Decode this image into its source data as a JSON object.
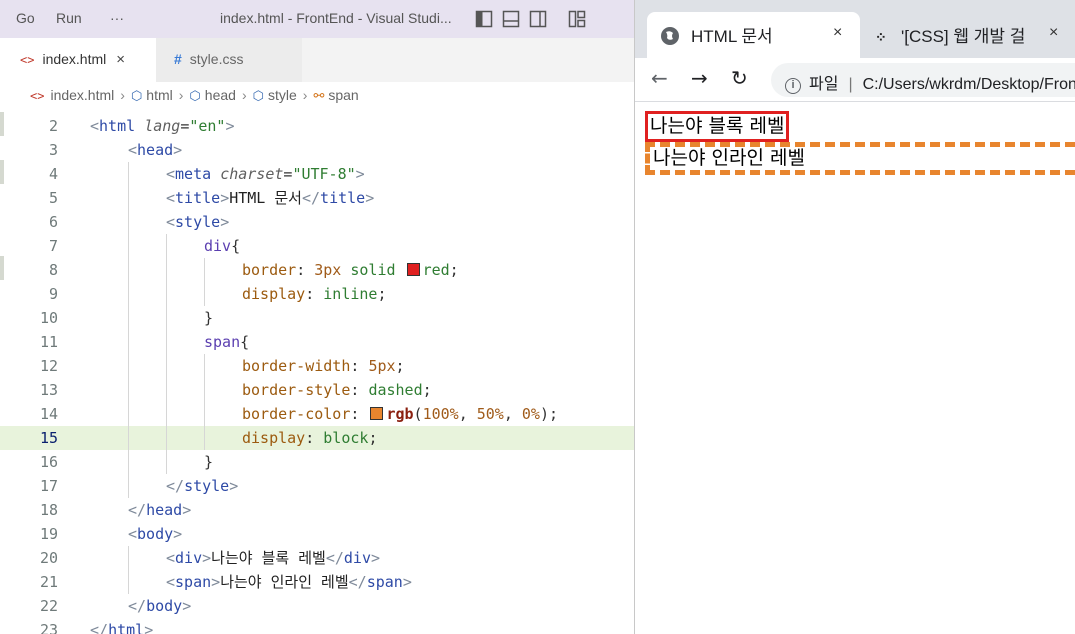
{
  "vscode": {
    "menu": [
      "Go",
      "Run",
      "···"
    ],
    "window_title": "index.html - FrontEnd - Visual Studi...",
    "tabs": [
      {
        "icon": "<>",
        "label": "index.html",
        "close": "×"
      },
      {
        "icon": "#",
        "label": "style.css"
      }
    ],
    "breadcrumbs": [
      "index.html",
      "html",
      "head",
      "style",
      "span"
    ],
    "breadcrumb_sep": "›",
    "current_line": 15,
    "lines": [
      {
        "n": "2",
        "indent": 0,
        "parts": [
          [
            "bracket",
            "<"
          ],
          [
            "tag",
            "html"
          ],
          [
            "text",
            " "
          ],
          [
            "attr",
            "lang"
          ],
          [
            "punc",
            "="
          ],
          [
            "str",
            "\"en\""
          ],
          [
            "bracket",
            ">"
          ]
        ]
      },
      {
        "n": "3",
        "indent": 1,
        "parts": [
          [
            "bracket",
            "<"
          ],
          [
            "tag",
            "head"
          ],
          [
            "bracket",
            ">"
          ]
        ]
      },
      {
        "n": "4",
        "indent": 2,
        "parts": [
          [
            "bracket",
            "<"
          ],
          [
            "tag",
            "meta"
          ],
          [
            "text",
            " "
          ],
          [
            "attr",
            "charset"
          ],
          [
            "punc",
            "="
          ],
          [
            "str",
            "\"UTF-8\""
          ],
          [
            "bracket",
            ">"
          ]
        ]
      },
      {
        "n": "5",
        "indent": 2,
        "parts": [
          [
            "bracket",
            "<"
          ],
          [
            "tag",
            "title"
          ],
          [
            "bracket",
            ">"
          ],
          [
            "text",
            "HTML 문서"
          ],
          [
            "bracket",
            "</"
          ],
          [
            "tag",
            "title"
          ],
          [
            "bracket",
            ">"
          ]
        ]
      },
      {
        "n": "6",
        "indent": 2,
        "parts": [
          [
            "bracket",
            "<"
          ],
          [
            "tag",
            "style"
          ],
          [
            "bracket",
            ">"
          ]
        ]
      },
      {
        "n": "7",
        "indent": 3,
        "parts": [
          [
            "sel",
            "div"
          ],
          [
            "punc",
            "{"
          ]
        ]
      },
      {
        "n": "8",
        "indent": 4,
        "parts": [
          [
            "prop",
            "border"
          ],
          [
            "punc",
            ": "
          ],
          [
            "num",
            "3px"
          ],
          [
            "val",
            " solid "
          ],
          [
            "swatch",
            "#e02020"
          ],
          [
            "val",
            "red"
          ],
          [
            "punc",
            ";"
          ]
        ]
      },
      {
        "n": "9",
        "indent": 4,
        "parts": [
          [
            "prop",
            "display"
          ],
          [
            "punc",
            ": "
          ],
          [
            "val",
            "inline"
          ],
          [
            "punc",
            ";"
          ]
        ]
      },
      {
        "n": "10",
        "indent": 3,
        "parts": [
          [
            "punc",
            "}"
          ]
        ]
      },
      {
        "n": "11",
        "indent": 3,
        "parts": [
          [
            "sel",
            "span"
          ],
          [
            "punc",
            "{"
          ]
        ]
      },
      {
        "n": "12",
        "indent": 4,
        "parts": [
          [
            "prop",
            "border-width"
          ],
          [
            "punc",
            ": "
          ],
          [
            "num",
            "5px"
          ],
          [
            "punc",
            ";"
          ]
        ]
      },
      {
        "n": "13",
        "indent": 4,
        "parts": [
          [
            "prop",
            "border-style"
          ],
          [
            "punc",
            ": "
          ],
          [
            "val",
            "dashed"
          ],
          [
            "punc",
            ";"
          ]
        ]
      },
      {
        "n": "14",
        "indent": 4,
        "parts": [
          [
            "prop",
            "border-color"
          ],
          [
            "punc",
            ": "
          ],
          [
            "swatch",
            "#e8852e"
          ],
          [
            "fn",
            "rgb"
          ],
          [
            "punc",
            "("
          ],
          [
            "num",
            "100%"
          ],
          [
            "punc",
            ", "
          ],
          [
            "num",
            "50%"
          ],
          [
            "punc",
            ", "
          ],
          [
            "num",
            "0%"
          ],
          [
            "punc",
            ");"
          ]
        ]
      },
      {
        "n": "15",
        "indent": 4,
        "parts": [
          [
            "prop",
            "display"
          ],
          [
            "punc",
            ": "
          ],
          [
            "val",
            "block"
          ],
          [
            "punc",
            ";"
          ]
        ]
      },
      {
        "n": "16",
        "indent": 3,
        "parts": [
          [
            "punc",
            "}"
          ]
        ]
      },
      {
        "n": "17",
        "indent": 2,
        "parts": [
          [
            "bracket",
            "</"
          ],
          [
            "tag",
            "style"
          ],
          [
            "bracket",
            ">"
          ]
        ]
      },
      {
        "n": "18",
        "indent": 1,
        "parts": [
          [
            "bracket",
            "</"
          ],
          [
            "tag",
            "head"
          ],
          [
            "bracket",
            ">"
          ]
        ]
      },
      {
        "n": "19",
        "indent": 1,
        "parts": [
          [
            "bracket",
            "<"
          ],
          [
            "tag",
            "body"
          ],
          [
            "bracket",
            ">"
          ]
        ]
      },
      {
        "n": "20",
        "indent": 2,
        "parts": [
          [
            "bracket",
            "<"
          ],
          [
            "tag",
            "div"
          ],
          [
            "bracket",
            ">"
          ],
          [
            "text",
            "나는야 블록 레벨"
          ],
          [
            "bracket",
            "</"
          ],
          [
            "tag",
            "div"
          ],
          [
            "bracket",
            ">"
          ]
        ]
      },
      {
        "n": "21",
        "indent": 2,
        "parts": [
          [
            "bracket",
            "<"
          ],
          [
            "tag",
            "span"
          ],
          [
            "bracket",
            ">"
          ],
          [
            "text",
            "나는야 인라인 레벨"
          ],
          [
            "bracket",
            "</"
          ],
          [
            "tag",
            "span"
          ],
          [
            "bracket",
            ">"
          ]
        ]
      },
      {
        "n": "22",
        "indent": 1,
        "parts": [
          [
            "bracket",
            "</"
          ],
          [
            "tag",
            "body"
          ],
          [
            "bracket",
            ">"
          ]
        ]
      },
      {
        "n": "23",
        "indent": 0,
        "parts": [
          [
            "bracket",
            "</"
          ],
          [
            "tag",
            "html"
          ],
          [
            "bracket",
            ">"
          ]
        ]
      }
    ]
  },
  "browser": {
    "active_tab": {
      "title": "HTML 문서",
      "close": "×"
    },
    "other_tab": {
      "title": "'[CSS] 웹 개발 걸",
      "close": "×"
    },
    "nav": {
      "back": "←",
      "forward": "→",
      "reload": "↻"
    },
    "omnibox": {
      "info": "i",
      "scheme_label": "파일",
      "sep": "|",
      "url": "C:/Users/wkrdm/Desktop/FrontEnd/index.html"
    },
    "page": {
      "div_text": "나는야 블록 레벨",
      "span_text": "나는야 인라인 레벨"
    }
  },
  "colors": {
    "div_border": "#e02020",
    "span_border": "#e8852e",
    "current_line_bg": "#e8f3dc"
  }
}
